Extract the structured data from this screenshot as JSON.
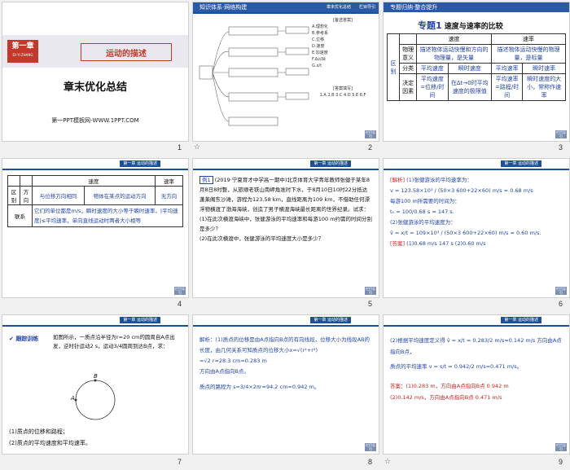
{
  "slides": {
    "s1": {
      "num": "1",
      "chapter": "第一章",
      "chapter_sub": "DI YI ZHANG",
      "title": "运动的描述",
      "subtitle": "章末优化总结",
      "footer": "第一PPT模板网-WWW.1PPT.COM"
    },
    "s2": {
      "num": "2",
      "header": "知识体系·网络构建",
      "tag": "章末优化总结",
      "tag2": "栏目导引",
      "side_title": "[备选答案]",
      "side_lines": [
        "A.理想化",
        "B.参考系",
        "C.位移",
        "D.速度",
        "E.加速度",
        "F.Δv/Δt",
        "G.x/t"
      ],
      "answer_label": "[答案填写]",
      "answers": "1.A  2.B  3.C  4.D  5.E  6.F",
      "nodes": [
        "质点",
        "参考系",
        "时间间隔",
        "时刻",
        "位移",
        "路程",
        "速度",
        "加速度"
      ]
    },
    "s3": {
      "num": "3",
      "header": "专题归纳·整合提升",
      "topic_num": "专题1",
      "topic": "速度与速率的比较",
      "col1": "速度",
      "col2": "速率",
      "side": "区别",
      "rows": [
        {
          "k": "物理意义",
          "a": "描述物体运动快慢和方向的物理量，是矢量",
          "b": "描述物体运动快慢的物理量，是标量"
        },
        {
          "k": "分类",
          "a1": "平均速度",
          "a2": "瞬时速度",
          "b1": "平均速率",
          "b2": "瞬时速率"
        },
        {
          "k": "决定因素",
          "a1": "平均速度=位移/时间",
          "a2": "在Δt→0时平均速度的极限值",
          "b1": "平均速率=路程/时间",
          "b2": "瞬时速度的大小，常称作速率"
        }
      ]
    },
    "s4": {
      "num": "4",
      "col1": "速度",
      "col2": "速率",
      "r1a": "区别",
      "r1b": "方向",
      "r1c": "与位移方向相同",
      "r1d": "物体在某点的运动方向",
      "r1e": "无方向",
      "r2a": "联系",
      "r2b": "它们的单位都是m/s，瞬时速度的大小等于瞬时速率，|平均速度|≤平均速率，单向直线运动时两者大小相等"
    },
    "s5": {
      "num": "5",
      "example": "例1",
      "body": "(2019·宁夏育才中学高一期中)北京体育大学青年教师张健于某年8月8日8时整，从旅顺老铁山南岬角准时下水，于8月10日10时22分抵达蓬莱阁东沙滩，游程为123.58 km，直线距离为109 km，不借助任何漂浮物横渡了渤海海峡，创造了男子横渡海峡最长距离的世界纪录。试求：",
      "q1": "(1)在此次横渡海峡中，张健游泳的平均速率和每游100 m约需的时间分别是多少？",
      "q2": "(2)在此次横渡中，张健游泳的平均速度大小是多少？"
    },
    "s6": {
      "num": "6",
      "analysis": "[解析]",
      "l1": "(1)张健游泳的平均速率为：",
      "l2": "v = 123.58×10³ / (50×3 600+22×60) m/s ≈ 0.68 m/s",
      "l3": "每游100 m所需要的时间为：",
      "l4": "t₀ = 100/0.68 s ≈ 147 s.",
      "l5": "(2)张健游泳的平均速度为：",
      "l6": "v̄ = x/t = 109×10³ / (50×3 600+22×60) m/s ≈ 0.60 m/s.",
      "ans": "[答案]",
      "ansv": "(1)0.68 m/s   147 s   (2)0.60 m/s"
    },
    "s7": {
      "num": "7",
      "train": "跟踪训练",
      "body": "如图所示，一质点沿半径为r=20 cm的圆周自A点出发，逆时针运动2 s，运动3/4圆周到达B点，求：",
      "pa": "A",
      "pb": "B",
      "q1": "(1)质点的位移和路程；",
      "q2": "(2)质点的平均速度和平均速率。"
    },
    "s8": {
      "num": "8",
      "l1": "解析：(1)质点的位移是由A点指向B点的有向线段，位移大小为线段AB的长度，由几何关系可知质点的位移大小x=√(r²+r²)",
      "l2": "=√2 r≈28.3 cm=0.283 m",
      "l3": "方向由A点指向B点。",
      "l4": "质点的路程为 s=3/4×2πr≈94.2 cm=0.942 m。"
    },
    "s9": {
      "num": "9",
      "l1": "(2)根据平均速度定义得 v̄ = x/t = 0.283/2 m/s≈0.142 m/s 方向由A点指向B点，",
      "l2": "质点的平均速率 v = s/t = 0.942/2 m/s=0.471 m/s。",
      "ans": "答案：(1)0.283 m，方向由A点指向B点   0.942 m",
      "ans2": "(2)0.142 m/s，方向由A点指向B点   0.471 m/s"
    },
    "chapter_tag": "第一章  运动的描述",
    "return_label": "栏目导引"
  }
}
